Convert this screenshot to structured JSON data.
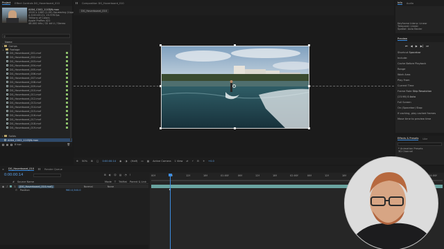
{
  "project_panel": {
    "tabs": [
      "Project",
      "Effect Controls DG_Hoverboard_010"
    ],
    "item_info": {
      "name": "A004_C002_1103JN.mov",
      "lines": [
        "1920 x 1080 (1.00) Squeezing (Upper)",
        "Δ 0:00:03:21, 23.976 fps",
        "Trillions of Colors",
        "Apple ProRes 422",
        "48.000 kHz / 32 bit U / Stereo"
      ]
    },
    "search_placeholder": "",
    "column_name": "Name",
    "folders": [
      "Comps",
      "Footage",
      "Solids"
    ],
    "comp_item": "DG_Hoverboard_010",
    "footage_items": [
      "DG_Hoverboard_001.mxf",
      "DG_Hoverboard_002.mxf",
      "DG_Hoverboard_003.mxf",
      "DG_Hoverboard_004.mxf",
      "DG_Hoverboard_005.mxf",
      "DG_Hoverboard_006.mxf",
      "DG_Hoverboard_007.mxf",
      "DG_Hoverboard_008.mxf",
      "DG_Hoverboard_009.mxf",
      "DG_Hoverboard_010.mxf",
      "DG_Hoverboard_011.mxf",
      "DG_Hoverboard_012.mxf",
      "DG_Hoverboard_013.mxf",
      "DG_Hoverboard_014.mxf",
      "DG_Hoverboard_015.mxf",
      "DG_Hoverboard_016.mxf",
      "DG_Hoverboard_017.mxf",
      "DG_Hoverboard_018.mxf",
      "DG_Hoverboard_019.mxf"
    ],
    "selected_item": "A004_C002_1103JN.mov",
    "bpc": "8 bpc"
  },
  "composition_panel": {
    "tab": "Composition DG_Hoverboard_010",
    "comp_tab": "DG_Hoverboard_010",
    "zoom": "50%",
    "timecode": "0:00:00:14",
    "resolution": "(Half)",
    "camera": "Active Camera",
    "views": "1 View",
    "exposure": "+0.0"
  },
  "right_panel": {
    "tabs": [
      "Info",
      "Audio"
    ],
    "info_lines": [
      "Keyframe Interp: Linear",
      "Temporal: Linear",
      "Spatial: Auto Bezier"
    ],
    "preview_tab": "Preview",
    "preview_rows": [
      {
        "label": "Shortcut",
        "value": "Spacebar"
      },
      {
        "label": "Include:",
        "value": ""
      },
      {
        "label": "Cache Before Playback",
        "value": ""
      },
      {
        "label": "Range",
        "value": ""
      },
      {
        "label": "Work Area",
        "value": ""
      },
      {
        "label": "Play From",
        "value": ""
      },
      {
        "label": "Current Time",
        "value": ""
      },
      {
        "label": "Frame Rate",
        "value": "Skip  Resolution"
      },
      {
        "label": "(23.98)",
        "value": "0     Auto"
      },
      {
        "label": "Full Screen",
        "value": ""
      },
      {
        "label": "On (Spacebar) Stop:",
        "value": ""
      },
      {
        "label": "If caching, play cached frames",
        "value": ""
      },
      {
        "label": "Move time to preview time",
        "value": ""
      }
    ],
    "effects_tabs": [
      "Effects & Presets",
      "Libr"
    ],
    "effects_items": [
      "* Animation Presets",
      "3D Channel"
    ]
  },
  "timeline": {
    "tabs": [
      "DG_Hoverboard_010",
      "Render Queue"
    ],
    "timecode": "0:00:00:14",
    "columns": [
      "#",
      "Source Name",
      "Mode",
      "T",
      "TrkMat",
      "Parent & Link"
    ],
    "layer": {
      "index": "1",
      "name": "[DG_Hoverboard_010.mxf]",
      "mode": "Normal",
      "parent": "None"
    },
    "sub_property": "Position",
    "sub_value": "960.0,540.0",
    "ruler_labels": [
      "00f",
      "06f",
      "12f",
      "18f",
      "01:00f",
      "06f",
      "12f",
      "18f",
      "02:00f",
      "06f",
      "12f",
      "18f",
      "03:00f",
      "06f",
      "12f",
      "18f",
      "04:00f"
    ]
  },
  "colors": {
    "accent_blue": "#3d8de0",
    "layer_bar": "#6aa4a0",
    "label_yellow": "#cfc16a",
    "label_green": "#8cc06a"
  }
}
